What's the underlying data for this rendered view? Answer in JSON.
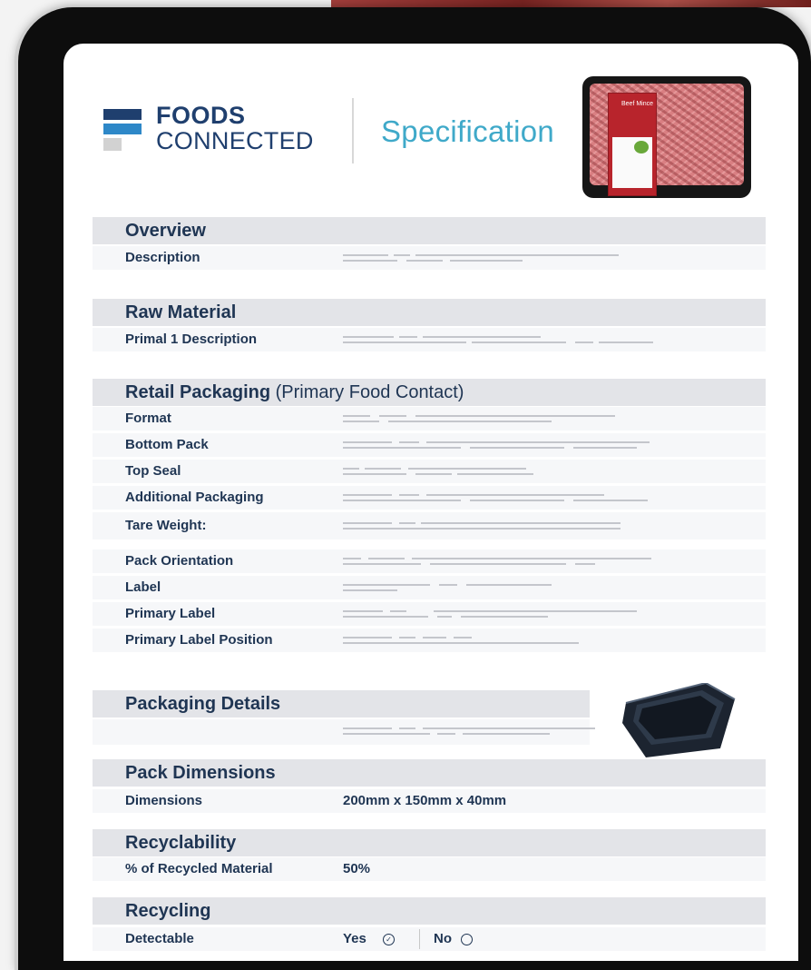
{
  "brand": {
    "line1": "FOODS",
    "line2": "CONNECTED"
  },
  "header": {
    "title": "Specification"
  },
  "product_label": {
    "text": "Beef Mince"
  },
  "sections": {
    "overview": {
      "title": "Overview",
      "rows": [
        {
          "label": "Description"
        }
      ]
    },
    "raw_material": {
      "title": "Raw Material",
      "rows": [
        {
          "label": "Primal 1 Description"
        }
      ]
    },
    "retail_packaging": {
      "title": "Retail Packaging",
      "subtitle": "(Primary Food Contact)",
      "rows": [
        {
          "label": "Format"
        },
        {
          "label": "Bottom Pack"
        },
        {
          "label": "Top Seal"
        },
        {
          "label": "Additional Packaging"
        },
        {
          "label": "Tare Weight:"
        },
        {
          "label": "Pack Orientation"
        },
        {
          "label": "Label"
        },
        {
          "label": "Primary Label"
        },
        {
          "label": "Primary Label Position"
        }
      ]
    },
    "packaging_details": {
      "title": "Packaging Details"
    },
    "pack_dimensions": {
      "title": "Pack Dimensions",
      "rows": [
        {
          "label": "Dimensions",
          "value": "200mm x 150mm x 40mm"
        }
      ]
    },
    "recyclability": {
      "title": "Recyclability",
      "rows": [
        {
          "label": "% of Recycled Material",
          "value": "50%"
        }
      ]
    },
    "recycling": {
      "title": "Recycling",
      "rows": [
        {
          "label": "Detectable",
          "yes": "Yes",
          "no": "No",
          "selected": "yes"
        }
      ]
    }
  },
  "colors": {
    "navy": "#1f3553",
    "accent": "#3fa9c9",
    "logo_blue": "#2e88c8",
    "header_bg": "#e3e4e8"
  }
}
